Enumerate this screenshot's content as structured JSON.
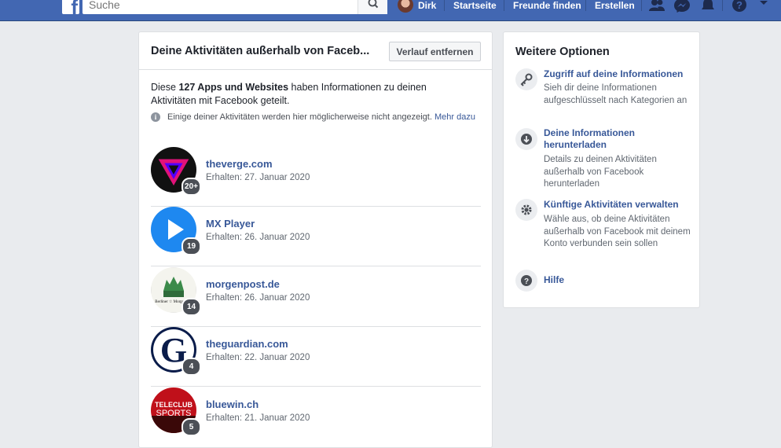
{
  "topbar": {
    "search_placeholder": "Suche",
    "user_name": "Dirk",
    "nav_home": "Startseite",
    "nav_find_friends": "Freunde finden",
    "nav_create": "Erstellen"
  },
  "main": {
    "title": "Deine Aktivitäten außerhalb von Faceb...",
    "clear_button": "Verlauf entfernen",
    "intro_prefix": "Diese ",
    "intro_bold": "127 Apps und Websites",
    "intro_suffix": " haben Informationen zu deinen Aktivitäten mit Facebook geteilt.",
    "info_text": "Einige deiner Aktivitäten werden hier möglicherweise nicht angezeigt. ",
    "info_link": "Mehr dazu",
    "apps": [
      {
        "name": "theverge.com",
        "received": "Erhalten: 27. Januar 2020",
        "count": "20+"
      },
      {
        "name": "MX Player",
        "received": "Erhalten: 26. Januar 2020",
        "count": "19"
      },
      {
        "name": "morgenpost.de",
        "received": "Erhalten: 26. Januar 2020",
        "count": "14"
      },
      {
        "name": "theguardian.com",
        "received": "Erhalten: 22. Januar 2020",
        "count": "4"
      },
      {
        "name": "bluewin.ch",
        "received": "Erhalten: 21. Januar 2020",
        "count": "5"
      }
    ],
    "logo_texts": {
      "morgenpost": "Berliner ☆ Morgenpost",
      "guardian": "G",
      "teleclub_1": "TELECLUB",
      "teleclub_2": "SPORTS"
    }
  },
  "side": {
    "title": "Weitere Optionen",
    "options": [
      {
        "link": "Zugriff auf deine Informationen",
        "desc": "Sieh dir deine Informationen aufgeschlüsselt nach Kategorien an",
        "icon": "key-icon"
      },
      {
        "link": "Deine Informationen herunterladen",
        "desc": "Details zu deinen Aktivitäten außerhalb von Facebook herunterladen",
        "icon": "download-icon"
      },
      {
        "link": "Künftige Aktivitäten verwalten",
        "desc": "Wähle aus, ob deine Aktivitäten außerhalb von Facebook mit deinem Konto verbunden sein sollen",
        "icon": "gear-icon"
      },
      {
        "link": "Hilfe",
        "desc": "",
        "icon": "help-icon"
      }
    ]
  },
  "colors": {
    "topbar": "#4267b2",
    "link": "#385898",
    "background": "#e9ebee"
  }
}
